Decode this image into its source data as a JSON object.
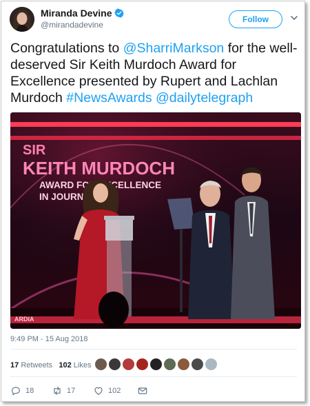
{
  "author": {
    "name": "Miranda Devine",
    "handle": "@mirandadevine",
    "follow_label": "Follow"
  },
  "tweet": {
    "text_1": "Congratulations to ",
    "mention_1": "@SharriMarkson",
    "text_2": " for the well-deserved Sir Keith Murdoch Award for Excellence presented by Rupert and Lachlan Murdoch ",
    "hashtag": "#NewsAwards",
    "text_3": " ",
    "mention_2": "@dailytelegraph"
  },
  "media": {
    "sign_line1": "SIR",
    "sign_line2": "KEITH MURDOCH",
    "sign_line3": "AWARD FOR EXCELLENCE",
    "sign_line4": "IN JOURNALISM",
    "bottom_sign": "ARDIA"
  },
  "timestamp": "9:49 PM - 15 Aug 2018",
  "stats": {
    "retweets_count": "17",
    "retweets_label": "Retweets",
    "likes_count": "102",
    "likes_label": "Likes"
  },
  "likers": [
    {
      "color": "#6d5a4e"
    },
    {
      "color": "#3a3838"
    },
    {
      "color": "#b33b3b"
    },
    {
      "color": "#a5251e"
    },
    {
      "color": "#222222"
    },
    {
      "color": "#5e6b55"
    },
    {
      "color": "#8a5a3c"
    },
    {
      "color": "#4b4b4b"
    },
    {
      "color": "#aab8c2"
    }
  ],
  "actions": {
    "reply_count": "18",
    "retweet_count": "17",
    "like_count": "102"
  }
}
